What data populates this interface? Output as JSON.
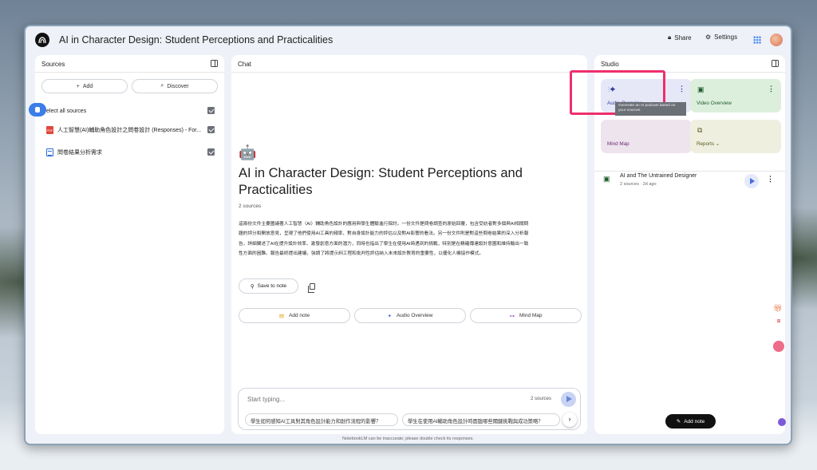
{
  "colors": {
    "accent": "#3b7de9",
    "highlight": "#ee2f6b",
    "audio_tile": "#e6e8f8",
    "video_tile": "#dcefdc",
    "mindmap_tile": "#ede4ee",
    "reports_tile": "#efefe0"
  },
  "app": {
    "title": "AI in Character Design: Student Perceptions and Practicalities",
    "share_label": "Share",
    "settings_label": "Settings"
  },
  "sources": {
    "header": "Sources",
    "add_label": "Add",
    "discover_label": "Discover",
    "select_all_label": "elect all sources",
    "items": [
      {
        "label": "人工智慧(AI)輔助角色設計之問卷設計 (Responses) - For...",
        "icon": "pdf-icon",
        "checked": true
      },
      {
        "label": "問卷結果分析需求",
        "icon": "doc-icon",
        "checked": true
      }
    ]
  },
  "chat": {
    "header": "Chat",
    "emoji": "🤖",
    "title": "AI in Character Design: Student Perceptions and Practicalities",
    "source_count": "2 sources",
    "summary": "這兩份文件主要圍繞著人工智慧（AI）輔助角色設計的應用與學生體驗進行探討。一份文件是問卷調查的原始回覆，包含受訪者對多個與AI相關問題的評分和開放意見，呈現了他們使用AI工具的頻率、對自身設計能力的評估以及對AI影響的看法。另一份文件則是對這些問卷結果的深入分析報告，詳細闡述了AI在提升設計效率、激發創意方面的潛力，同時也指出了學生在使用AI時遇到的挑戰，特別是在精確傳達設計意圖和維持輸出一致性方面的困難。報告最終提出建議，強調了將提示詞工程和批判性評估納入未來設計教育的重要性，以優化人機協作模式。",
    "save_note_label": "Save to note",
    "quick_actions": [
      {
        "label": "Add note",
        "icon": "note-icon"
      },
      {
        "label": "Audio Overview",
        "icon": "sparkle-icon"
      },
      {
        "label": "Mind Map",
        "icon": "mindmap-icon"
      }
    ],
    "composer": {
      "placeholder": "Start typing...",
      "source_count": "2 sources"
    },
    "suggestions": [
      "學生如何感知AI工具對其角色設計能力和創作流程的影響？",
      "學生在使用AI輔助角色設計時面臨哪些關鍵挑戰與成功策略？"
    ]
  },
  "studio": {
    "header": "Studio",
    "tiles": [
      {
        "label": "Audio Overview",
        "icon": "audio-sparkle-icon"
      },
      {
        "label": "Video Overview",
        "icon": "video-icon"
      },
      {
        "label": "Mind Map",
        "icon": "mindmap-icon"
      },
      {
        "label": "Reports",
        "icon": "reports-icon"
      }
    ],
    "tooltip": "Generate an AI podcast based on your sources",
    "audio_item": {
      "title": "AI and The Untrained Designer",
      "meta": "2 sources · 2d ago"
    },
    "add_note_label": "Add note"
  },
  "footer": "NotebookLM can be inaccurate; please double check its responses."
}
